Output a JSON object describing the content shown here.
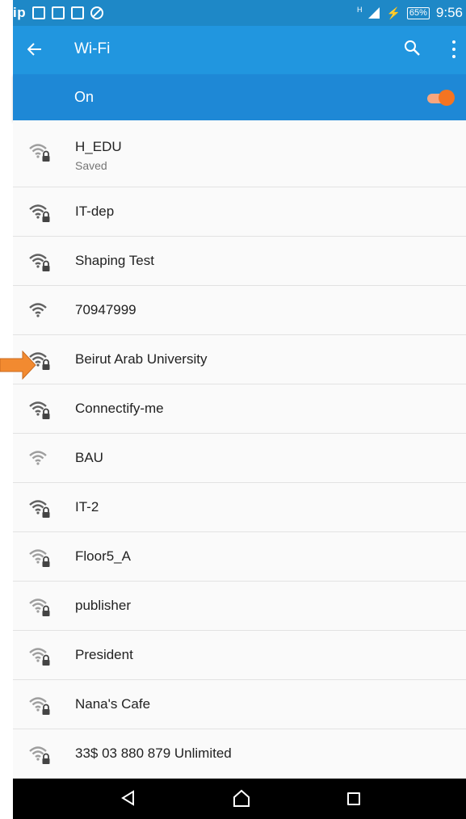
{
  "status_bar": {
    "left_text": "ip",
    "battery": "65%",
    "time": "9:56",
    "network": "H"
  },
  "app_bar": {
    "title": "Wi-Fi",
    "back_icon": "arrow-back-icon",
    "search_icon": "search-icon",
    "menu_icon": "more-vert-icon"
  },
  "wifi_toggle": {
    "label": "On",
    "state": true
  },
  "networks": [
    {
      "name": "H_EDU",
      "sub": "Saved",
      "secured": true
    },
    {
      "name": "IT-dep",
      "secured": true
    },
    {
      "name": "Shaping Test",
      "secured": true
    },
    {
      "name": "70947999",
      "secured": false
    },
    {
      "name": "Beirut Arab University",
      "secured": true
    },
    {
      "name": "Connectify-me",
      "secured": true
    },
    {
      "name": "BAU",
      "secured": false
    },
    {
      "name": "IT-2",
      "secured": true
    },
    {
      "name": "Floor5_A",
      "secured": true
    },
    {
      "name": "publisher",
      "secured": true
    },
    {
      "name": "President",
      "secured": true
    },
    {
      "name": "Nana's Cafe",
      "secured": true
    },
    {
      "name": "33$ 03 880 879 Unlimited",
      "secured": true
    }
  ],
  "nav_bar": {
    "back": "nav-back-icon",
    "home": "nav-home-icon",
    "recent": "nav-recents-icon"
  },
  "colors": {
    "status_bar": "#1e88c7",
    "app_bar": "#2196df",
    "on_bar": "#1e88d6",
    "toggle": "#f47421",
    "annotation_arrow": "#f28a30"
  }
}
